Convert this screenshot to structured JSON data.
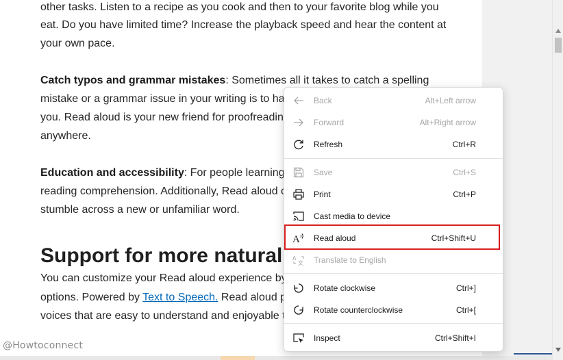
{
  "article": {
    "lines": [
      "other tasks. Listen to a recipe as you cook and then to your favorite blog while you",
      "eat. Do you have limited time? Increase the playback speed and hear the content at",
      "your own pace."
    ],
    "typos_bold": "Catch typos and grammar mistakes",
    "typos_line1": ": Sometimes all it takes to catch a spelling",
    "typos_line2": "mistake or a grammar issue in your writing is to ha",
    "typos_line3": "you. Read aloud is your new friend for proofreadin",
    "typos_line4": "anywhere.",
    "edu_bold": "Education and accessibility",
    "edu_line1": ": For people learning t",
    "edu_line2": "reading comprehension. Additionally, Read aloud c",
    "edu_line3": "stumble across a new or unfamiliar word.",
    "heading": "Support for more natural v",
    "cust_line1": "You can customize your Read aloud experience by",
    "cust_line2_pre": "options. Powered by ",
    "cust_link": "Text to Speech.",
    "cust_line2_post": " Read aloud p",
    "cust_line3": "voices that are easy to understand and enjoyable t"
  },
  "watermark": "@Howtoconnect",
  "menu": {
    "items": [
      {
        "label": "Back",
        "shortcut": "Alt+Left arrow",
        "icon": "back-arrow-icon",
        "enabled": false
      },
      {
        "label": "Forward",
        "shortcut": "Alt+Right arrow",
        "icon": "forward-arrow-icon",
        "enabled": false
      },
      {
        "label": "Refresh",
        "shortcut": "Ctrl+R",
        "icon": "refresh-icon",
        "enabled": true
      },
      {
        "label": "Save",
        "shortcut": "Ctrl+S",
        "icon": "save-icon",
        "enabled": false
      },
      {
        "label": "Print",
        "shortcut": "Ctrl+P",
        "icon": "print-icon",
        "enabled": true
      },
      {
        "label": "Cast media to device",
        "shortcut": "",
        "icon": "cast-icon",
        "enabled": true
      },
      {
        "label": "Read aloud",
        "shortcut": "Ctrl+Shift+U",
        "icon": "read-aloud-icon",
        "enabled": true
      },
      {
        "label": "Translate to English",
        "shortcut": "",
        "icon": "translate-icon",
        "enabled": false
      },
      {
        "label": "Rotate clockwise",
        "shortcut": "Ctrl+]",
        "icon": "rotate-clockwise-icon",
        "enabled": true
      },
      {
        "label": "Rotate counterclockwise",
        "shortcut": "Ctrl+[",
        "icon": "rotate-counterclockwise-icon",
        "enabled": true
      },
      {
        "label": "Inspect",
        "shortcut": "Ctrl+Shift+I",
        "icon": "inspect-icon",
        "enabled": true
      }
    ]
  },
  "colors": {
    "highlight": "#d81e1e",
    "link": "#0067b8",
    "disabled_text": "#a6a6a6"
  }
}
